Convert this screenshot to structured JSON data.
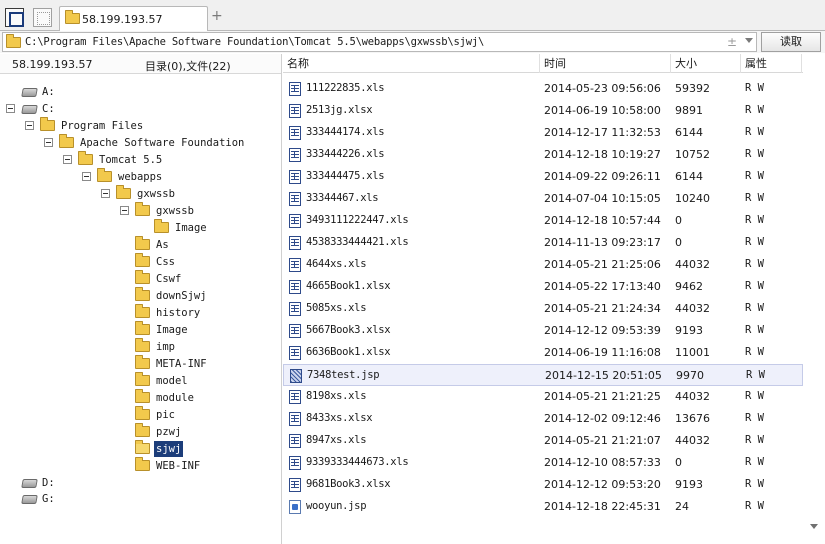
{
  "tabbar": {
    "tab_label": "58.199.193.57",
    "add_tab": "+"
  },
  "address": {
    "path": "C:\\Program Files\\Apache Software Foundation\\Tomcat 5.5\\webapps\\gxwssb\\sjwj\\",
    "plus": "±",
    "read_button": "读取"
  },
  "left": {
    "host": "58.199.193.57",
    "count": "目录(0),文件(22)",
    "tree": [
      {
        "label": "A:",
        "icon": "drive-icon"
      },
      {
        "label": "C:",
        "icon": "drive-icon"
      },
      {
        "label": "Program Files",
        "icon": "folder-icon"
      },
      {
        "label": "Apache Software Foundation",
        "icon": "folder-icon"
      },
      {
        "label": "Tomcat 5.5",
        "icon": "folder-icon"
      },
      {
        "label": "webapps",
        "icon": "folder-icon"
      },
      {
        "label": "gxwssb",
        "icon": "folder-icon"
      },
      {
        "label": "gxwssb",
        "icon": "folder-icon"
      },
      {
        "label": "Image",
        "icon": "folder-icon"
      },
      {
        "label": "As",
        "icon": "folder-icon"
      },
      {
        "label": "Css",
        "icon": "folder-icon"
      },
      {
        "label": "Cswf",
        "icon": "folder-icon"
      },
      {
        "label": "downSjwj",
        "icon": "folder-icon"
      },
      {
        "label": "history",
        "icon": "folder-icon"
      },
      {
        "label": "Image",
        "icon": "folder-icon"
      },
      {
        "label": "imp",
        "icon": "folder-icon"
      },
      {
        "label": "META-INF",
        "icon": "folder-icon"
      },
      {
        "label": "model",
        "icon": "folder-icon"
      },
      {
        "label": "module",
        "icon": "folder-icon"
      },
      {
        "label": "pic",
        "icon": "folder-icon"
      },
      {
        "label": "pzwj",
        "icon": "folder-icon"
      },
      {
        "label": "sjwj",
        "icon": "folder-icon",
        "selected": true
      },
      {
        "label": "WEB-INF",
        "icon": "folder-icon"
      },
      {
        "label": "D:",
        "icon": "drive-icon"
      },
      {
        "label": "G:",
        "icon": "drive-icon"
      }
    ]
  },
  "columns": {
    "name": "名称",
    "time": "时间",
    "size": "大小",
    "attr": "属性"
  },
  "files": [
    {
      "name": "111222835.xls",
      "time": "2014-05-23 09:56:06",
      "size": "59392",
      "attr": "R W",
      "type": "xls"
    },
    {
      "name": "2513jg.xlsx",
      "time": "2014-06-19 10:58:00",
      "size": "9891",
      "attr": "R W",
      "type": "xls"
    },
    {
      "name": "333444174.xls",
      "time": "2014-12-17 11:32:53",
      "size": "6144",
      "attr": "R W",
      "type": "xls"
    },
    {
      "name": "333444226.xls",
      "time": "2014-12-18 10:19:27",
      "size": "10752",
      "attr": "R W",
      "type": "xls"
    },
    {
      "name": "333444475.xls",
      "time": "2014-09-22 09:26:11",
      "size": "6144",
      "attr": "R W",
      "type": "xls"
    },
    {
      "name": "33344467.xls",
      "time": "2014-07-04 10:15:05",
      "size": "10240",
      "attr": "R W",
      "type": "xls"
    },
    {
      "name": "3493111222447.xls",
      "time": "2014-12-18 10:57:44",
      "size": "0",
      "attr": "R W",
      "type": "xls"
    },
    {
      "name": "4538333444421.xls",
      "time": "2014-11-13 09:23:17",
      "size": "0",
      "attr": "R W",
      "type": "xls"
    },
    {
      "name": "4644xs.xls",
      "time": "2014-05-21 21:25:06",
      "size": "44032",
      "attr": "R W",
      "type": "xls"
    },
    {
      "name": "4665Book1.xlsx",
      "time": "2014-05-22 17:13:40",
      "size": "9462",
      "attr": "R W",
      "type": "xls"
    },
    {
      "name": "5085xs.xls",
      "time": "2014-05-21 21:24:34",
      "size": "44032",
      "attr": "R W",
      "type": "xls"
    },
    {
      "name": "5667Book3.xlsx",
      "time": "2014-12-12 09:53:39",
      "size": "9193",
      "attr": "R W",
      "type": "xls"
    },
    {
      "name": "6636Book1.xlsx",
      "time": "2014-06-19 11:16:08",
      "size": "11001",
      "attr": "R W",
      "type": "xls"
    },
    {
      "name": "7348test.jsp",
      "time": "2014-12-15 20:51:05",
      "size": "9970",
      "attr": "R W",
      "type": "jspx",
      "highlighted": true
    },
    {
      "name": "8198xs.xls",
      "time": "2014-05-21 21:21:25",
      "size": "44032",
      "attr": "R W",
      "type": "xls"
    },
    {
      "name": "8433xs.xlsx",
      "time": "2014-12-02 09:12:46",
      "size": "13676",
      "attr": "R W",
      "type": "xls"
    },
    {
      "name": "8947xs.xls",
      "time": "2014-05-21 21:21:07",
      "size": "44032",
      "attr": "R W",
      "type": "xls"
    },
    {
      "name": "9339333444673.xls",
      "time": "2014-12-10 08:57:33",
      "size": "0",
      "attr": "R W",
      "type": "xls"
    },
    {
      "name": "9681Book3.xlsx",
      "time": "2014-12-12 09:53:20",
      "size": "9193",
      "attr": "R W",
      "type": "xls"
    },
    {
      "name": "wooyun.jsp",
      "time": "2014-12-18 22:45:31",
      "size": "24",
      "attr": "R W",
      "type": "jsp"
    }
  ],
  "colors": {
    "selection": "#1c3d7a",
    "row_highlight": "#eef0fb",
    "folder": "#f2c94c"
  }
}
